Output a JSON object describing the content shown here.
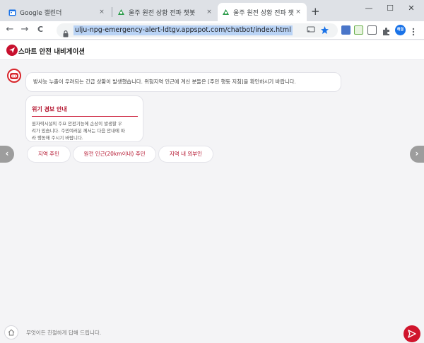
{
  "browser": {
    "tabs": [
      {
        "title": "Google 캘린더",
        "close": "×",
        "icon": "calendar-icon"
      },
      {
        "title": "울주 원전 상황 전파 챗봇",
        "close": "×",
        "icon": "robot-icon"
      },
      {
        "title": "울주 원전 상황 전파 챗봇",
        "close": "×",
        "icon": "robot-icon"
      }
    ],
    "new_tab": "+",
    "window_controls": {
      "minimize": "—",
      "maximize": "☐",
      "close": "✕"
    },
    "nav": {
      "back": "←",
      "forward": "→",
      "reload": "C"
    },
    "url": "ulju-npg-emergency-alert-ldtgv.appspot.com/chatbot/index.html",
    "extensions": {
      "profile_badge": "해결"
    }
  },
  "app": {
    "title": "스마트 안전 내비게이션"
  },
  "chat": {
    "bot_message": "방사능 누출이 우려되는 긴급 상황이 발생했습니다. 위험지역 인근에 계신 분들은 [주민 행동 지침]을 확인하시기 바랍니다.",
    "card": {
      "title": "위기 경보 안내",
      "body_lines": [
        "원자력시설의 주요 안전기능에 손상이 발생할 우",
        "려가 있습니다. 주민여러분 께서는 다음 안내에 따",
        "라 행동해 주시기 바랍니다."
      ]
    },
    "quick_replies": [
      "지역 주민",
      "원전 인근(20km이내) 주민",
      "지역 내 외부인"
    ],
    "carousel": {
      "prev": "‹",
      "next": "›"
    }
  },
  "input": {
    "placeholder": "무엇이든 친절하게 답해 드립니다."
  },
  "colors": {
    "brand_red": "#c8102e",
    "chrome_tabstrip": "#dee1e6",
    "chat_background": "#f4f4f6"
  }
}
